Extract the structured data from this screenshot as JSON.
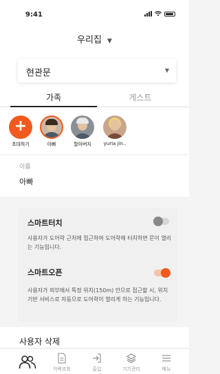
{
  "status_bar": {
    "time": "9:41"
  },
  "header": {
    "home_title": "우리집"
  },
  "door_select": {
    "value": "현관문"
  },
  "tabs": {
    "family": "가족",
    "guest": "게스트"
  },
  "members": [
    {
      "name": "초대하기",
      "icon": "plus-icon"
    },
    {
      "name": "아빠"
    },
    {
      "name": "할아버지"
    },
    {
      "name": "yuria jin.."
    }
  ],
  "name_section": {
    "label": "이름",
    "value": "아빠"
  },
  "smart_touch": {
    "title": "스마트터치",
    "description": "사용자가 도어락 근처에 접근하여 도어락에 터치하면 문이 열리는 기능입니다.",
    "enabled": false
  },
  "smart_open": {
    "title": "스마트오픈",
    "description": "사용자가 외부에서 특정 위치(150m) 안으로 접근할 시, 위치기반 서비스로 자동으로 도어락이 열리게 하는 기능입니다.",
    "enabled": true
  },
  "delete_user": {
    "label": "사용자 삭제"
  },
  "bottom_nav": [
    {
      "label": "",
      "icon": "users-icon"
    },
    {
      "label": "이력조회",
      "icon": "document-icon"
    },
    {
      "label": "출입",
      "icon": "login-icon"
    },
    {
      "label": "기기관리",
      "icon": "layers-icon"
    },
    {
      "label": "메뉴",
      "icon": "menu-icon"
    }
  ],
  "colors": {
    "accent": "#f05a1e",
    "text": "#222222",
    "muted": "#999999"
  }
}
